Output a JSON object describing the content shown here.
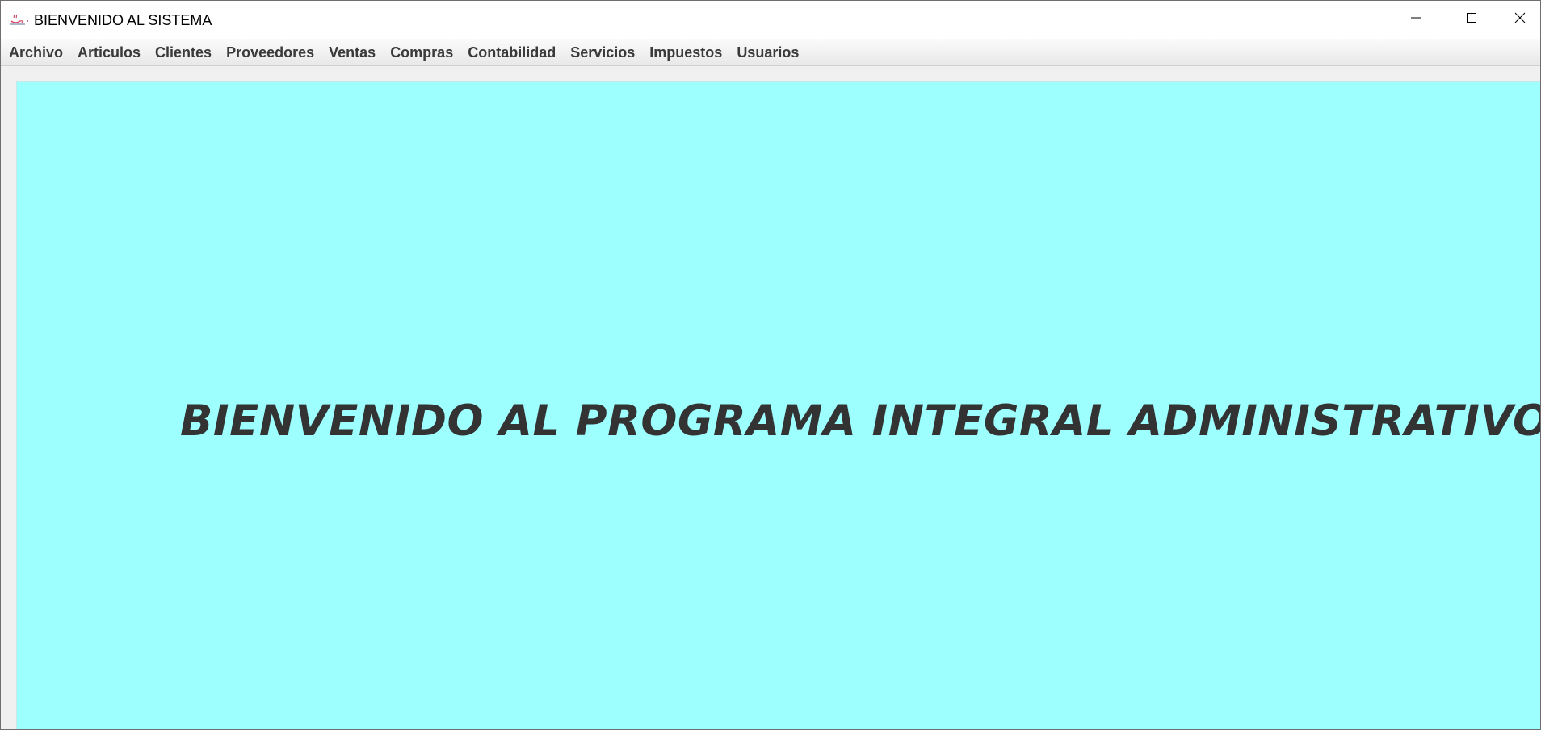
{
  "window": {
    "title": "BIENVENIDO AL SISTEMA",
    "app_icon": "java-coffee-cup-icon",
    "controls": {
      "minimize_icon": "minimize-icon",
      "maximize_icon": "maximize-icon",
      "close_icon": "close-icon"
    }
  },
  "menubar": {
    "items": [
      {
        "label": "Archivo"
      },
      {
        "label": "Articulos"
      },
      {
        "label": "Clientes"
      },
      {
        "label": "Proveedores"
      },
      {
        "label": "Ventas"
      },
      {
        "label": "Compras"
      },
      {
        "label": "Contabilidad"
      },
      {
        "label": "Servicios"
      },
      {
        "label": "Impuestos"
      },
      {
        "label": "Usuarios"
      }
    ]
  },
  "desktop": {
    "welcome_text": "BIENVENIDO AL PROGRAMA INTEGRAL ADMINISTRATIVO"
  },
  "colors": {
    "desktop_background": "#9effff",
    "welcome_text": "#333333",
    "menu_text": "#3a3a3a"
  }
}
